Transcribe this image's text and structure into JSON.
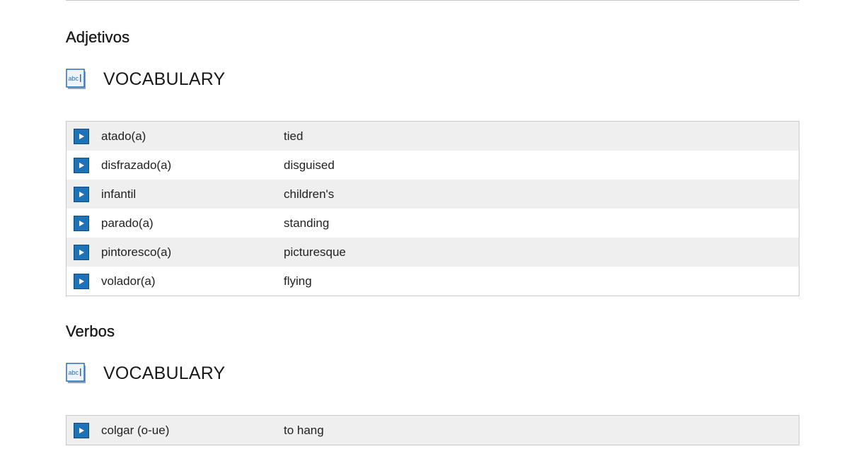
{
  "sections": [
    {
      "heading": "Adjetivos",
      "vocab_label": "VOCABULARY",
      "items": [
        {
          "term": "atado(a)",
          "translation": "tied"
        },
        {
          "term": "disfrazado(a)",
          "translation": "disguised"
        },
        {
          "term": "infantil",
          "translation": "children's"
        },
        {
          "term": "parado(a)",
          "translation": "standing"
        },
        {
          "term": "pintoresco(a)",
          "translation": "picturesque"
        },
        {
          "term": "volador(a)",
          "translation": "flying"
        }
      ]
    },
    {
      "heading": "Verbos",
      "vocab_label": "VOCABULARY",
      "items": [
        {
          "term": "colgar (o-ue)",
          "translation": "to hang"
        }
      ]
    }
  ],
  "icons": {
    "vocab": "abc-vocabulary-icon",
    "play": "play-audio-icon"
  },
  "colors": {
    "play_button": "#1e72b8",
    "row_alt": "#efefef",
    "icon_text": "#2a6db4"
  }
}
